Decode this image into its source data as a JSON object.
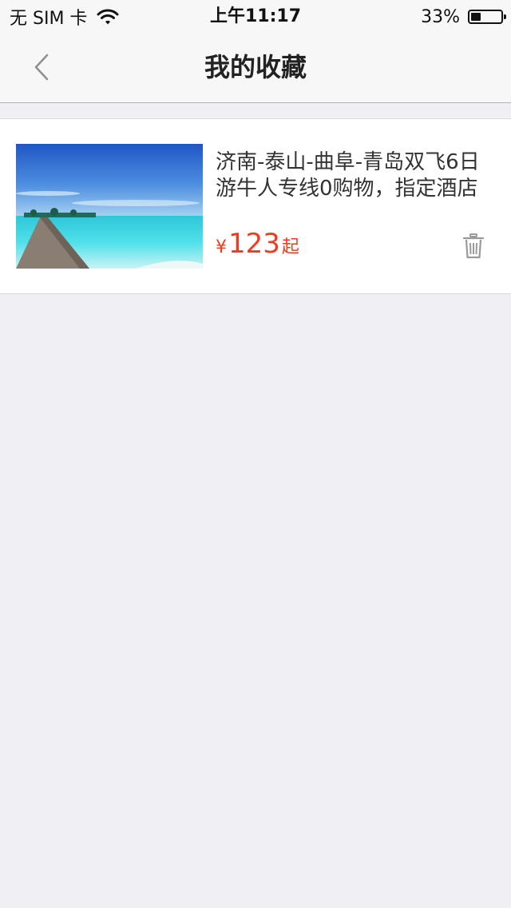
{
  "status_bar": {
    "carrier": "无 SIM 卡",
    "time": "上午11:17",
    "battery_percent_label": "33%",
    "battery_level": 0.33
  },
  "nav": {
    "title": "我的收藏",
    "back_icon": "chevron-left-icon"
  },
  "favorites": [
    {
      "title": "济南-泰山-曲阜-青岛双飞6日游牛人专线0购物，指定酒店",
      "price_currency": "¥",
      "price_amount": "123",
      "price_suffix": "起",
      "thumbnail": "beach-pier-image",
      "delete_icon": "trash-icon"
    }
  ],
  "colors": {
    "background": "#efeff4",
    "price": "#f03c1e",
    "nav_bg": "#f7f7f8"
  }
}
